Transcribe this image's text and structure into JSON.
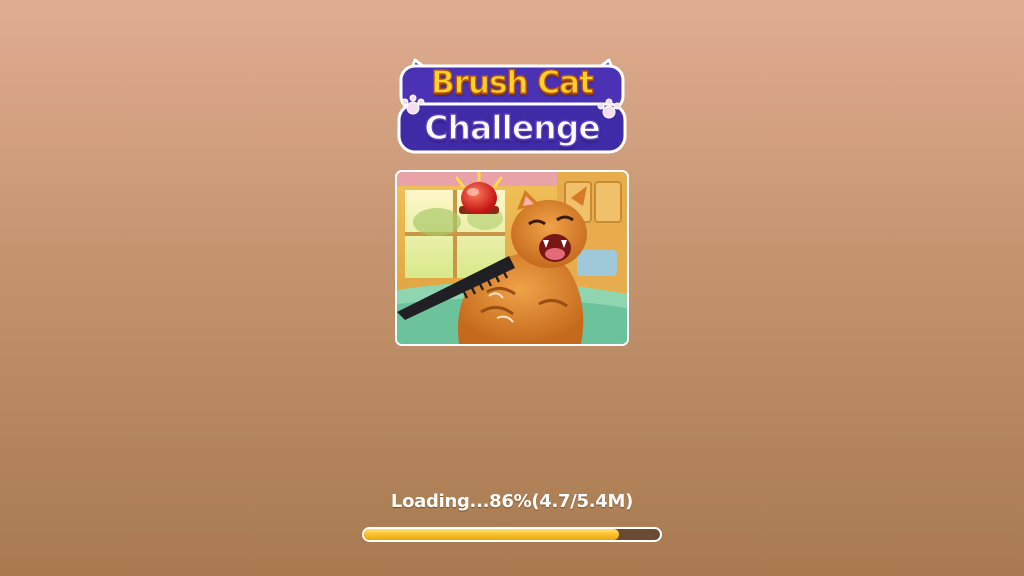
{
  "logo": {
    "line1": "Brush Cat",
    "line2": "Challenge"
  },
  "artwork": {
    "subject": "angry orange cat being brushed with a comb, red alarm siren"
  },
  "loading": {
    "text": "Loading...86%(4.7/5.4M)",
    "percent": 86,
    "loaded_mb": 4.7,
    "total_mb": 5.4
  },
  "colors": {
    "background_top": "#dfad90",
    "background_bottom": "#a87a4e",
    "progress_fill": "#f9c12c",
    "progress_track": "#6b4a33",
    "logo_yellow": "#ffd12a",
    "logo_purple": "#4b32b4"
  }
}
